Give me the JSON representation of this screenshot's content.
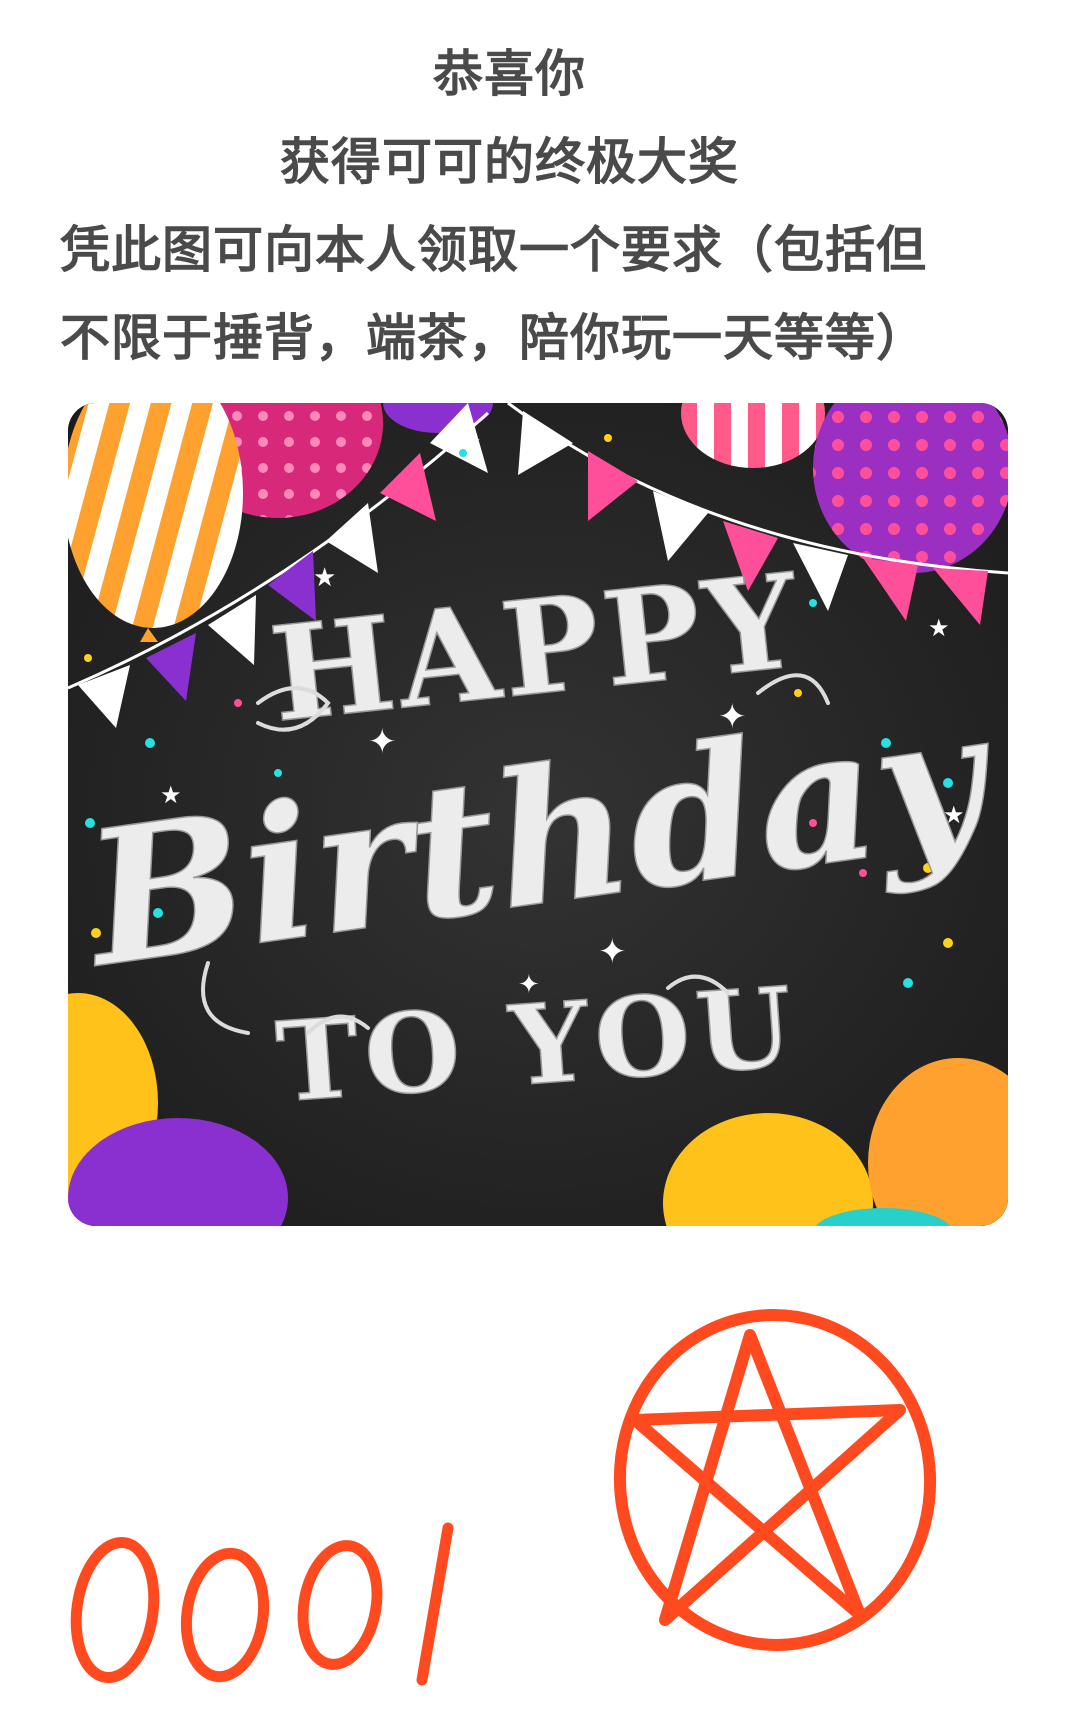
{
  "message": {
    "line1": "恭喜你",
    "line2": "获得可可的终极大奖",
    "line3": "凭此图可向本人领取一个要求（包括但",
    "line4": "不限于捶背，端茶，陪你玩一天等等）"
  },
  "card": {
    "text_happy": "HAPPY",
    "text_birthday": "Birthday",
    "text_to_you": "TO YOU"
  },
  "serial_number": "0001",
  "colors": {
    "text": "#4a4a4a",
    "handwriting": "#ff4a1f",
    "board": "#242424",
    "chalk": "#ececec",
    "pink": "#ff4f9a",
    "purple": "#8a2fd0",
    "orange": "#ffa12e",
    "yellow": "#ffc21a"
  },
  "icons": [
    "star-icon",
    "balloon-icon",
    "pennant-icon"
  ]
}
